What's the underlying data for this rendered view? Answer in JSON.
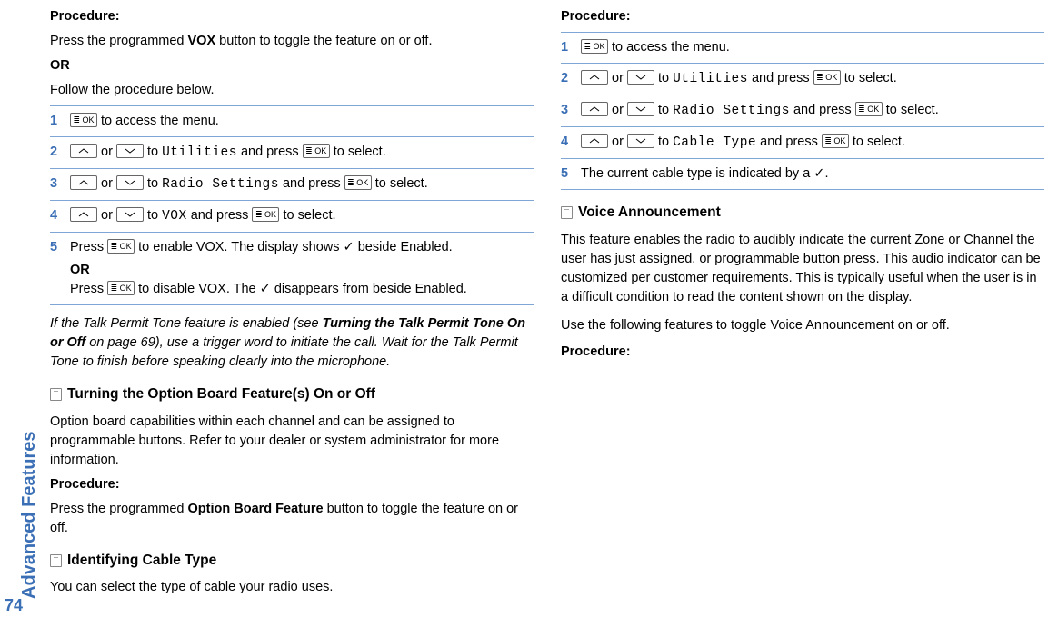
{
  "sidebar": {
    "label": "Advanced Features",
    "page_number": "74"
  },
  "left": {
    "procedure_label": "Procedure:",
    "intro_line1a": "Press the programmed ",
    "intro_vox": "VOX",
    "intro_line1b": " button to toggle the feature on or off.",
    "or": "OR",
    "intro_line2": "Follow the procedure below.",
    "steps": {
      "s1": {
        "num": "1",
        "text": " to access the menu."
      },
      "s2": {
        "num": "2",
        "or": " or ",
        "to": " to ",
        "target": "Utilities",
        "and": " and press ",
        "tail": " to select."
      },
      "s3": {
        "num": "3",
        "or": " or ",
        "to": " to ",
        "target": "Radio Settings",
        "and": " and press ",
        "tail": " to select."
      },
      "s4": {
        "num": "4",
        "or": " or ",
        "to": " to ",
        "target": "VOX",
        "and": " and press ",
        "tail": " to select."
      },
      "s5": {
        "num": "5",
        "press": "Press ",
        "enable": " to enable VOX. The display shows ✓ beside Enabled.",
        "or": "OR",
        "disable1": "Press ",
        "disable2": " to disable VOX. The ✓ disappears from beside Enabled."
      }
    },
    "note1a": "If the Talk Permit Tone feature is enabled (see ",
    "note1b": "Turning the Talk Permit Tone On or Off",
    "note1c": " on page 69), use a trigger word to initiate the call. Wait for the Talk Permit Tone to finish before speaking clearly into the microphone.",
    "section2_title": "Turning the Option Board Feature(s) On or Off",
    "section2_body": "Option board capabilities within each channel and can be assigned to programmable buttons. Refer to your dealer or system administrator for more information."
  },
  "right": {
    "procedure_label": "Procedure:",
    "intro_a": "Press the programmed ",
    "intro_bold": "Option Board Feature",
    "intro_b": " button to toggle the feature on or off.",
    "sectionA_title": "Identifying Cable Type",
    "sectionA_body": "You can select the type of cable your radio uses.",
    "procA_label": "Procedure:",
    "stepsA": {
      "s1": {
        "num": "1",
        "text": " to access the menu."
      },
      "s2": {
        "num": "2",
        "or": " or ",
        "to": " to ",
        "target": "Utilities",
        "and": " and press ",
        "tail": " to select."
      },
      "s3": {
        "num": "3",
        "or": " or ",
        "to": " to ",
        "target": "Radio Settings",
        "and": " and press ",
        "tail": " to select."
      },
      "s4": {
        "num": "4",
        "or": " or ",
        "to": " to ",
        "target": "Cable Type",
        "and": " and press ",
        "tail": " to select."
      },
      "s5": {
        "num": "5",
        "text": "The current cable type is indicated by a ✓."
      }
    },
    "sectionB_title": "Voice Announcement",
    "sectionB_body1": "This feature enables the radio to audibly indicate the current Zone or Channel the user has just assigned, or programmable button press. This audio indicator can be customized per customer requirements. This is typically useful when the user is in a difficult condition to read the content shown on the display.",
    "sectionB_body2": "Use the following features to toggle Voice Announcement on or off.",
    "procB_label": "Procedure:"
  },
  "keys": {
    "ok": "≣ OK",
    "up": "▲",
    "down": "▼"
  }
}
